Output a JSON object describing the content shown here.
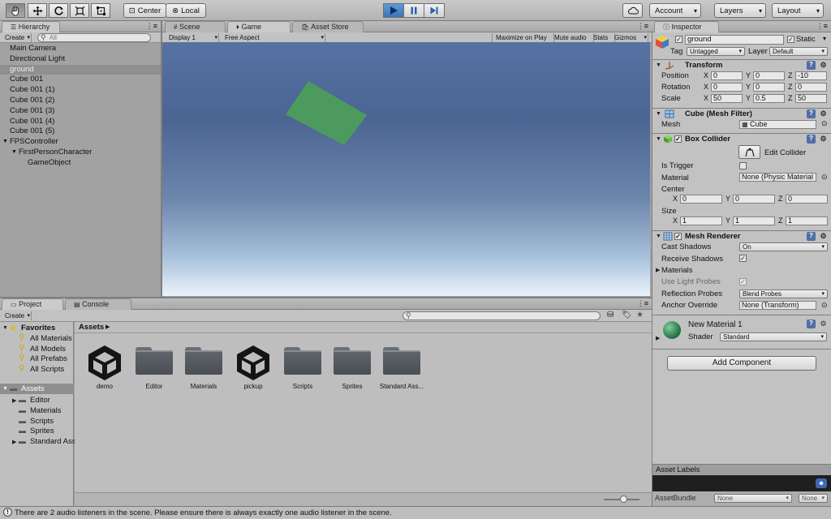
{
  "toolbar": {
    "tools": [
      "hand-icon",
      "move-icon",
      "rotate-icon",
      "scale-icon",
      "rect-icon"
    ],
    "pivot_label": "Center",
    "space_label": "Local",
    "account_label": "Account",
    "layers_label": "Layers",
    "layout_label": "Layout"
  },
  "hierarchy": {
    "tab_label": "Hierarchy",
    "create_label": "Create",
    "search_placeholder": "All",
    "items": [
      {
        "label": "Main Camera",
        "indent": 0
      },
      {
        "label": "Directional Light",
        "indent": 0
      },
      {
        "label": "ground",
        "indent": 0,
        "selected": true
      },
      {
        "label": "Cube 001",
        "indent": 0
      },
      {
        "label": "Cube 001 (1)",
        "indent": 0
      },
      {
        "label": "Cube 001 (2)",
        "indent": 0
      },
      {
        "label": "Cube 001 (3)",
        "indent": 0
      },
      {
        "label": "Cube 001 (4)",
        "indent": 0
      },
      {
        "label": "Cube 001 (5)",
        "indent": 0
      },
      {
        "label": "FPSController",
        "indent": 0,
        "expanded": true
      },
      {
        "label": "FirstPersonCharacter",
        "indent": 1,
        "expanded": true
      },
      {
        "label": "GameObject",
        "indent": 2
      }
    ]
  },
  "center_tabs": {
    "scene": "Scene",
    "game": "Game",
    "asset_store": "Asset Store"
  },
  "game_bar": {
    "display": "Display 1",
    "aspect": "Free Aspect",
    "maximize": "Maximize on Play",
    "mute": "Mute audio",
    "stats": "Stats",
    "gizmos": "Gizmos"
  },
  "inspector": {
    "tab_label": "Inspector",
    "object_name": "ground",
    "static_label": "Static",
    "tag_label": "Tag",
    "tag_value": "Untagged",
    "layer_label": "Layer",
    "layer_value": "Default",
    "transform": {
      "title": "Transform",
      "position_label": "Position",
      "rotation_label": "Rotation",
      "scale_label": "Scale",
      "position": [
        "0",
        "0",
        "-10"
      ],
      "rotation": [
        "0",
        "0",
        "0"
      ],
      "scale": [
        "50",
        "0.5",
        "50"
      ]
    },
    "mesh_filter": {
      "title": "Cube (Mesh Filter)",
      "mesh_label": "Mesh",
      "mesh_value": "Cube"
    },
    "box_collider": {
      "title": "Box Collider",
      "edit_label": "Edit Collider",
      "is_trigger_label": "Is Trigger",
      "material_label": "Material",
      "material_value": "None (Physic Material",
      "center_label": "Center",
      "center": [
        "0",
        "0",
        "0"
      ],
      "size_label": "Size",
      "size": [
        "1",
        "1",
        "1"
      ]
    },
    "mesh_renderer": {
      "title": "Mesh Renderer",
      "cast_shadows_label": "Cast Shadows",
      "cast_shadows_value": "On",
      "receive_shadows_label": "Receive Shadows",
      "materials_label": "Materials",
      "light_probes_label": "Use Light Probes",
      "reflection_label": "Reflection Probes",
      "reflection_value": "Blend Probes",
      "anchor_label": "Anchor Override",
      "anchor_value": "None (Transform)"
    },
    "material": {
      "name": "New Material 1",
      "shader_label": "Shader",
      "shader_value": "Standard"
    },
    "add_component": "Add Component",
    "asset_labels": "Asset Labels",
    "asset_bundle_label": "AssetBundle",
    "asset_bundle_value": "None",
    "asset_bundle_variant": "None"
  },
  "project": {
    "tab_label": "Project",
    "console_label": "Console",
    "create_label": "Create",
    "favorites_label": "Favorites",
    "favorites": [
      "All Materials",
      "All Models",
      "All Prefabs",
      "All Scripts"
    ],
    "assets_label": "Assets",
    "folders": [
      "Editor",
      "Materials",
      "Scripts",
      "Sprites",
      "Standard Ass"
    ],
    "breadcrumb": "Assets",
    "assets": [
      {
        "label": "demo",
        "kind": "unity"
      },
      {
        "label": "Editor",
        "kind": "folder"
      },
      {
        "label": "Materials",
        "kind": "folder"
      },
      {
        "label": "pickup",
        "kind": "unity"
      },
      {
        "label": "Scripts",
        "kind": "folder"
      },
      {
        "label": "Sprites",
        "kind": "folder"
      },
      {
        "label": "Standard Ass...",
        "kind": "folder"
      }
    ]
  },
  "status": "There are 2 audio listeners in the scene. Please ensure there is always exactly one audio listener in the scene."
}
